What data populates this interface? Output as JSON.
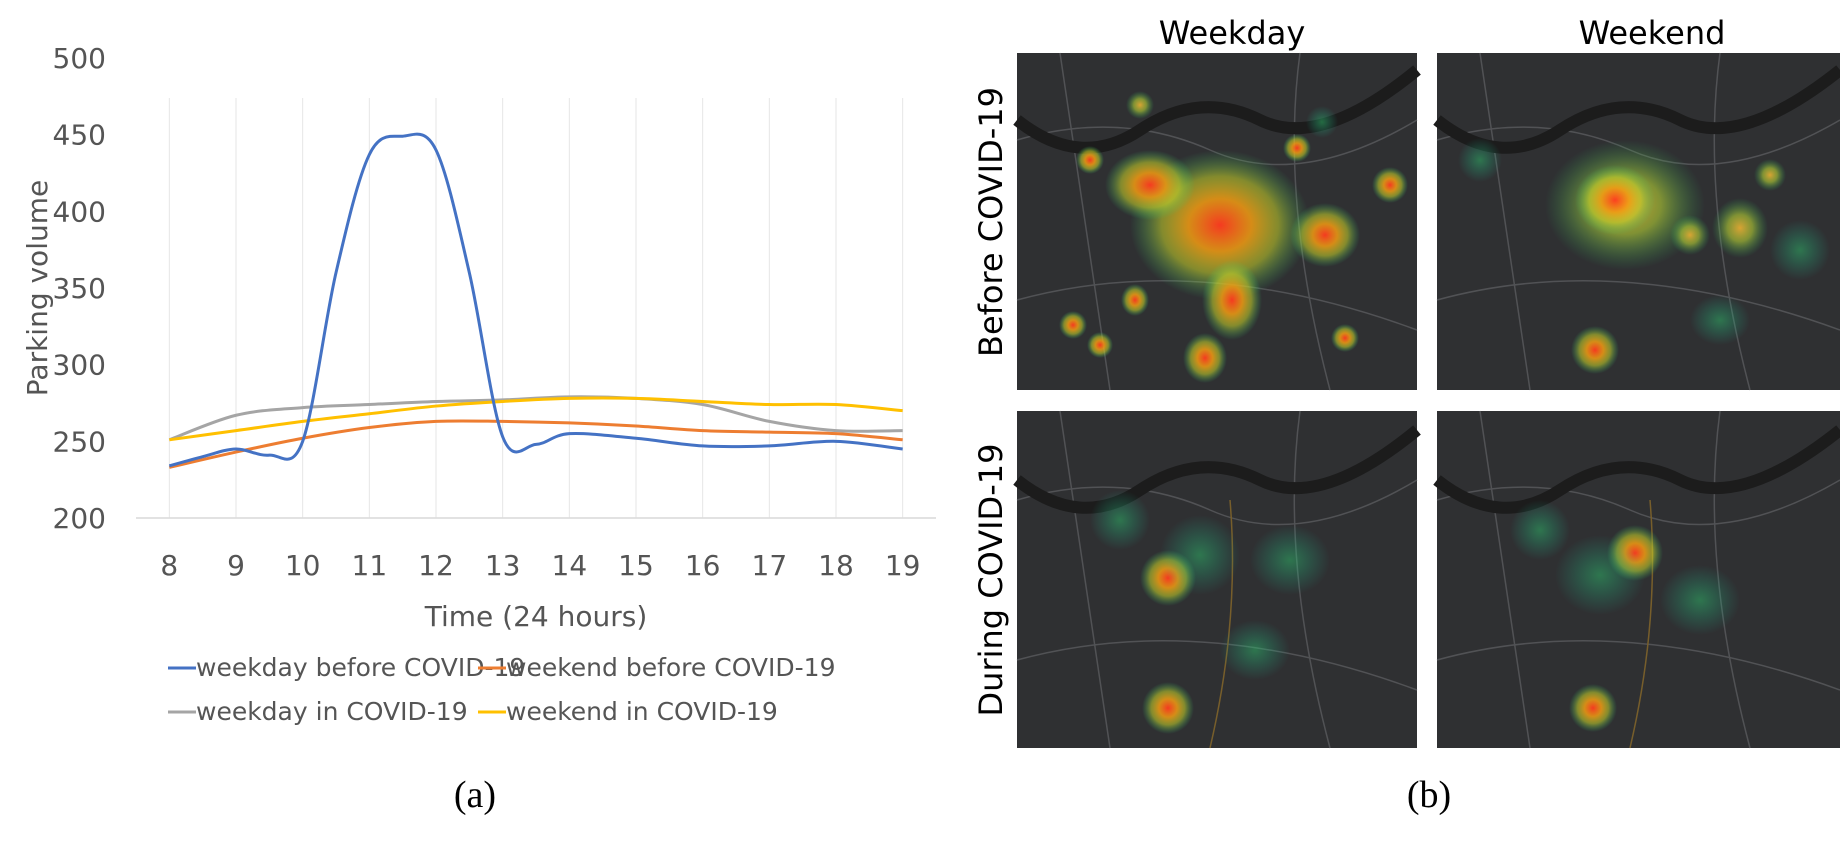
{
  "chart_data": {
    "type": "line",
    "caption": "(a)",
    "xlabel": "Time (24 hours)",
    "ylabel": "Parking volume",
    "ylim": [
      200,
      500
    ],
    "yticks": [
      200,
      250,
      300,
      350,
      400,
      450,
      500
    ],
    "x": [
      8,
      9,
      10,
      11,
      12,
      13,
      14,
      15,
      16,
      17,
      18,
      19
    ],
    "grid": "vertical",
    "legend_position": "bottom",
    "series": [
      {
        "name": "weekday before COVID-19",
        "color": "#4472C4",
        "points": [
          [
            8,
            234
          ],
          [
            8.5,
            240
          ],
          [
            9,
            245
          ],
          [
            9.5,
            241
          ],
          [
            10,
            250
          ],
          [
            10.5,
            360
          ],
          [
            11,
            437
          ],
          [
            11.5,
            449
          ],
          [
            12,
            440
          ],
          [
            12.5,
            360
          ],
          [
            13,
            253
          ],
          [
            13.5,
            248
          ],
          [
            14,
            255
          ],
          [
            15,
            252
          ],
          [
            16,
            247
          ],
          [
            17,
            247
          ],
          [
            18,
            250
          ],
          [
            19,
            245
          ]
        ]
      },
      {
        "name": "weekend before COVID-19",
        "color": "#ED7D31",
        "points": [
          [
            8,
            233
          ],
          [
            9,
            243
          ],
          [
            10,
            252
          ],
          [
            11,
            259
          ],
          [
            12,
            263
          ],
          [
            13,
            263
          ],
          [
            14,
            262
          ],
          [
            15,
            260
          ],
          [
            16,
            257
          ],
          [
            17,
            256
          ],
          [
            18,
            255
          ],
          [
            19,
            251
          ]
        ]
      },
      {
        "name": "weekday in COVID-19",
        "color": "#A5A5A5",
        "points": [
          [
            8,
            251
          ],
          [
            9,
            267
          ],
          [
            10,
            272
          ],
          [
            11,
            274
          ],
          [
            12,
            276
          ],
          [
            13,
            277
          ],
          [
            14,
            279
          ],
          [
            15,
            278
          ],
          [
            16,
            274
          ],
          [
            17,
            263
          ],
          [
            18,
            257
          ],
          [
            19,
            257
          ]
        ]
      },
      {
        "name": "weekend in COVID-19",
        "color": "#FFC000",
        "points": [
          [
            8,
            251
          ],
          [
            9,
            257
          ],
          [
            10,
            263
          ],
          [
            11,
            268
          ],
          [
            12,
            273
          ],
          [
            13,
            276
          ],
          [
            14,
            278
          ],
          [
            15,
            278
          ],
          [
            16,
            276
          ],
          [
            17,
            274
          ],
          [
            18,
            274
          ],
          [
            19,
            270
          ]
        ]
      }
    ]
  },
  "heatmap_panel": {
    "caption": "(b)",
    "column_titles": [
      "Weekday",
      "Weekend"
    ],
    "row_titles": [
      "Before COVID-19",
      "During COVID-19"
    ]
  }
}
